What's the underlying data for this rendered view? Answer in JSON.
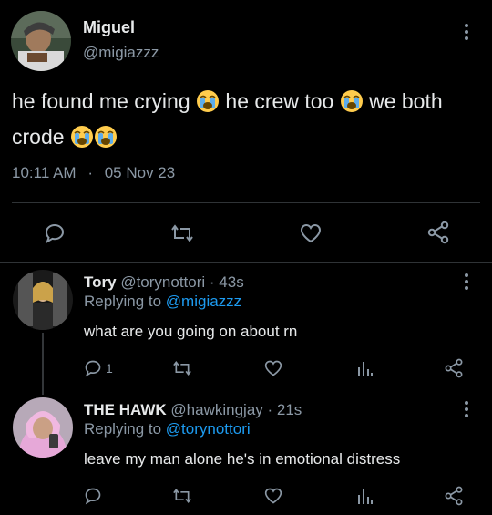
{
  "main_tweet": {
    "author_name": "Miguel",
    "author_handle": "@migiazzz",
    "text_line1_a": "he found me crying",
    "text_line1_b": "he crew too",
    "text_line1_c": "we both",
    "text_line2": "crode",
    "emoji": "loudly-crying-face",
    "time": "10:11 AM",
    "separator": "·",
    "date": "05 Nov 23"
  },
  "replies": [
    {
      "name": "Tory",
      "handle": "@torynottori",
      "age": "· 43s",
      "replying_label": "Replying to",
      "replying_to": "@migiazzz",
      "text": "what are you going on about rn",
      "reply_count": "1"
    },
    {
      "name": "THE HAWK",
      "handle": "@hawkingjay",
      "age": "· 21s",
      "replying_label": "Replying to",
      "replying_to": "@torynottori",
      "text": "leave my man alone he's in emotional distress"
    }
  ],
  "colors": {
    "background": "#000000",
    "text": "#e7e9ea",
    "muted": "#8b98a5",
    "link": "#1d9bf0",
    "divider": "#2f3336"
  }
}
